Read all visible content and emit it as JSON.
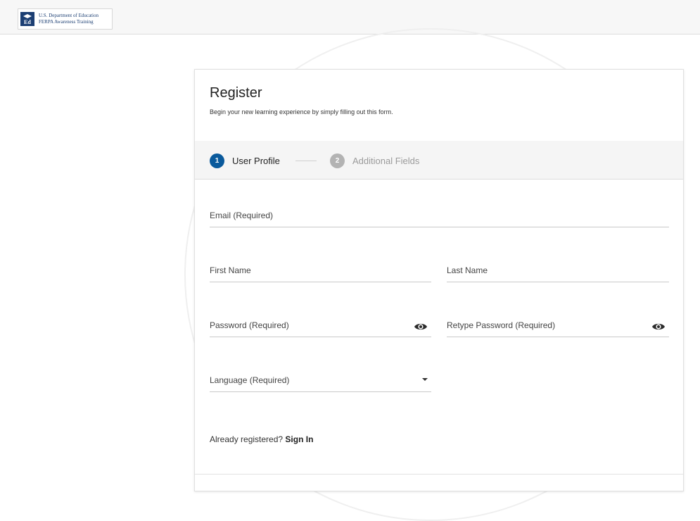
{
  "header": {
    "logo_line1": "U.S. Department of Education",
    "logo_line2": "FERPA Awareness Training",
    "logo_icon": "ed-seal-icon"
  },
  "register": {
    "title": "Register",
    "subtitle": "Begin your new learning experience by simply filling out this form."
  },
  "steps": [
    {
      "number": "1",
      "label": "User Profile",
      "state": "active",
      "color": "#0a5a9c"
    },
    {
      "number": "2",
      "label": "Additional Fields",
      "state": "inactive",
      "color": "#b3b3b3"
    }
  ],
  "form": {
    "email": {
      "label": "Email (Required)"
    },
    "first_name": {
      "label": "First Name"
    },
    "last_name": {
      "label": "Last Name"
    },
    "password": {
      "label": "Password (Required)",
      "icon": "eye-icon"
    },
    "retype_password": {
      "label": "Retype Password (Required)",
      "icon": "eye-icon"
    },
    "language": {
      "label": "Language (Required)",
      "icon": "caret-down-icon"
    }
  },
  "signin": {
    "prompt": "Already registered?",
    "link": "Sign In"
  },
  "colors": {
    "accent": "#0a5a9c",
    "brand_navy": "#1c3f73",
    "inactive_step": "#b3b3b3"
  }
}
